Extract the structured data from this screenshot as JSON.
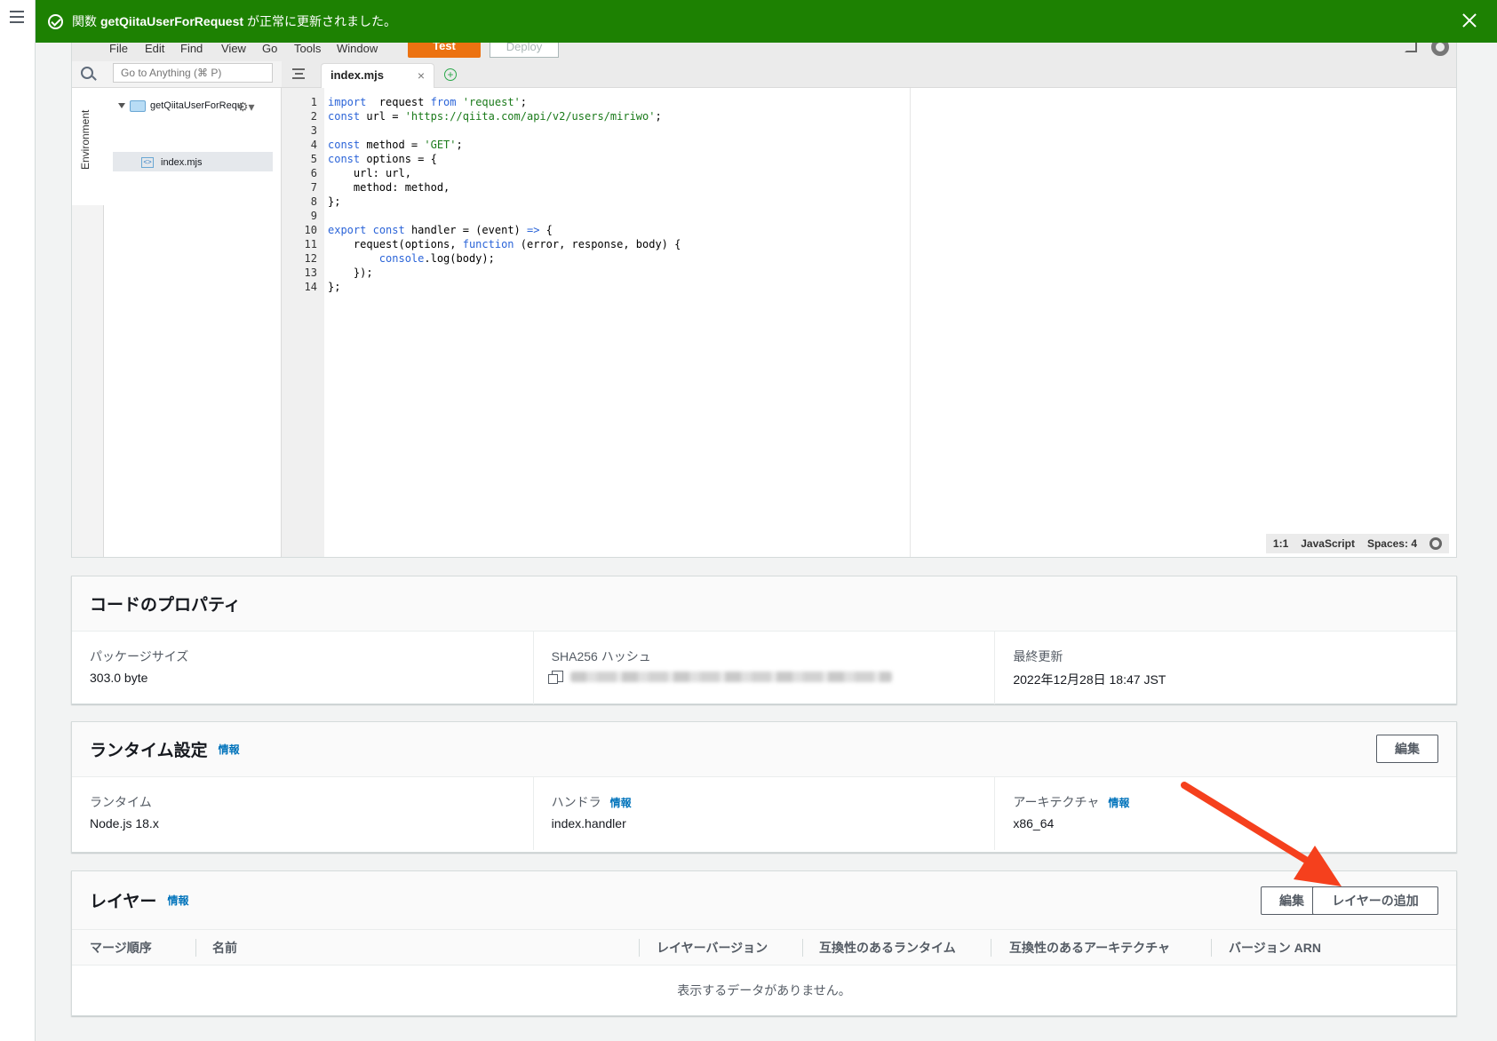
{
  "nav": {
    "menu_icon": "hamburger-menu-icon"
  },
  "flash": {
    "prefix": "関数",
    "function_name": "getQiitaUserForRequest",
    "suffix": "が正常に更新されました。",
    "status_icon": "success-check-icon",
    "close_icon": "close-icon",
    "color": "#1d8102"
  },
  "ide": {
    "menu": [
      "File",
      "Edit",
      "Find",
      "View",
      "Go",
      "Tools",
      "Window"
    ],
    "test_label": "Test",
    "deploy_label": "Deploy",
    "search_placeholder": "Go to Anything (⌘ P)",
    "environment_label": "Environment",
    "tree": {
      "folder": "getQiitaUserForRequ",
      "file": "index.mjs"
    },
    "tab_name": "index.mjs",
    "tab_close": "×",
    "add_tab": "+",
    "code": [
      [
        [
          "kw",
          "import"
        ],
        [
          "",
          "  request "
        ],
        [
          "kw",
          "from"
        ],
        [
          "",
          ""
        ],
        [
          "str",
          " 'request'"
        ],
        [
          "",
          ";"
        ]
      ],
      [
        [
          "kw",
          "const"
        ],
        [
          "",
          " url = "
        ],
        [
          "str",
          "'https://qiita.com/api/v2/users/miriwo'"
        ],
        [
          "",
          ";"
        ]
      ],
      [
        [
          "",
          ""
        ]
      ],
      [
        [
          "kw",
          "const"
        ],
        [
          "",
          " method = "
        ],
        [
          "str",
          "'GET'"
        ],
        [
          "",
          ";"
        ]
      ],
      [
        [
          "kw",
          "const"
        ],
        [
          "",
          " options = {"
        ]
      ],
      [
        [
          "",
          "    url: url,"
        ]
      ],
      [
        [
          "",
          "    method: method,"
        ]
      ],
      [
        [
          "",
          "};"
        ]
      ],
      [
        [
          "",
          ""
        ]
      ],
      [
        [
          "kw",
          "export"
        ],
        [
          "",
          " "
        ],
        [
          "kw",
          "const"
        ],
        [
          "",
          " handler = (event) "
        ],
        [
          "kw",
          "=>"
        ],
        [
          "",
          " {"
        ]
      ],
      [
        [
          "",
          "    request(options, "
        ],
        [
          "kw",
          "function"
        ],
        [
          "",
          " (error, response, body) {"
        ]
      ],
      [
        [
          "",
          "        "
        ],
        [
          "fn",
          "console"
        ],
        [
          "",
          ".log(body);"
        ]
      ],
      [
        [
          "",
          "    });"
        ]
      ],
      [
        [
          "",
          "};"
        ]
      ]
    ],
    "status": {
      "position": "1:1",
      "language": "JavaScript",
      "spaces": "Spaces: 4"
    }
  },
  "code_properties": {
    "title": "コードのプロパティ",
    "package_size_label": "パッケージサイズ",
    "package_size": "303.0 byte",
    "sha_label": "SHA256 ハッシュ",
    "last_modified_label": "最終更新",
    "last_modified": "2022年12月28日 18:47 JST"
  },
  "runtime": {
    "title": "ランタイム設定",
    "info": "情報",
    "edit": "編集",
    "runtime_label": "ランタイム",
    "runtime_value": "Node.js 18.x",
    "handler_label": "ハンドラ",
    "handler_info": "情報",
    "handler_value": "index.handler",
    "arch_label": "アーキテクチャ",
    "arch_info": "情報",
    "arch_value": "x86_64"
  },
  "layers": {
    "title": "レイヤー",
    "info": "情報",
    "edit": "編集",
    "add": "レイヤーの追加",
    "columns": [
      "マージ順序",
      "名前",
      "レイヤーバージョン",
      "互換性のあるランタイム",
      "互換性のあるアーキテクチャ",
      "バージョン ARN"
    ],
    "empty": "表示するデータがありません。"
  },
  "annotation": {
    "color": "#f5401d"
  }
}
